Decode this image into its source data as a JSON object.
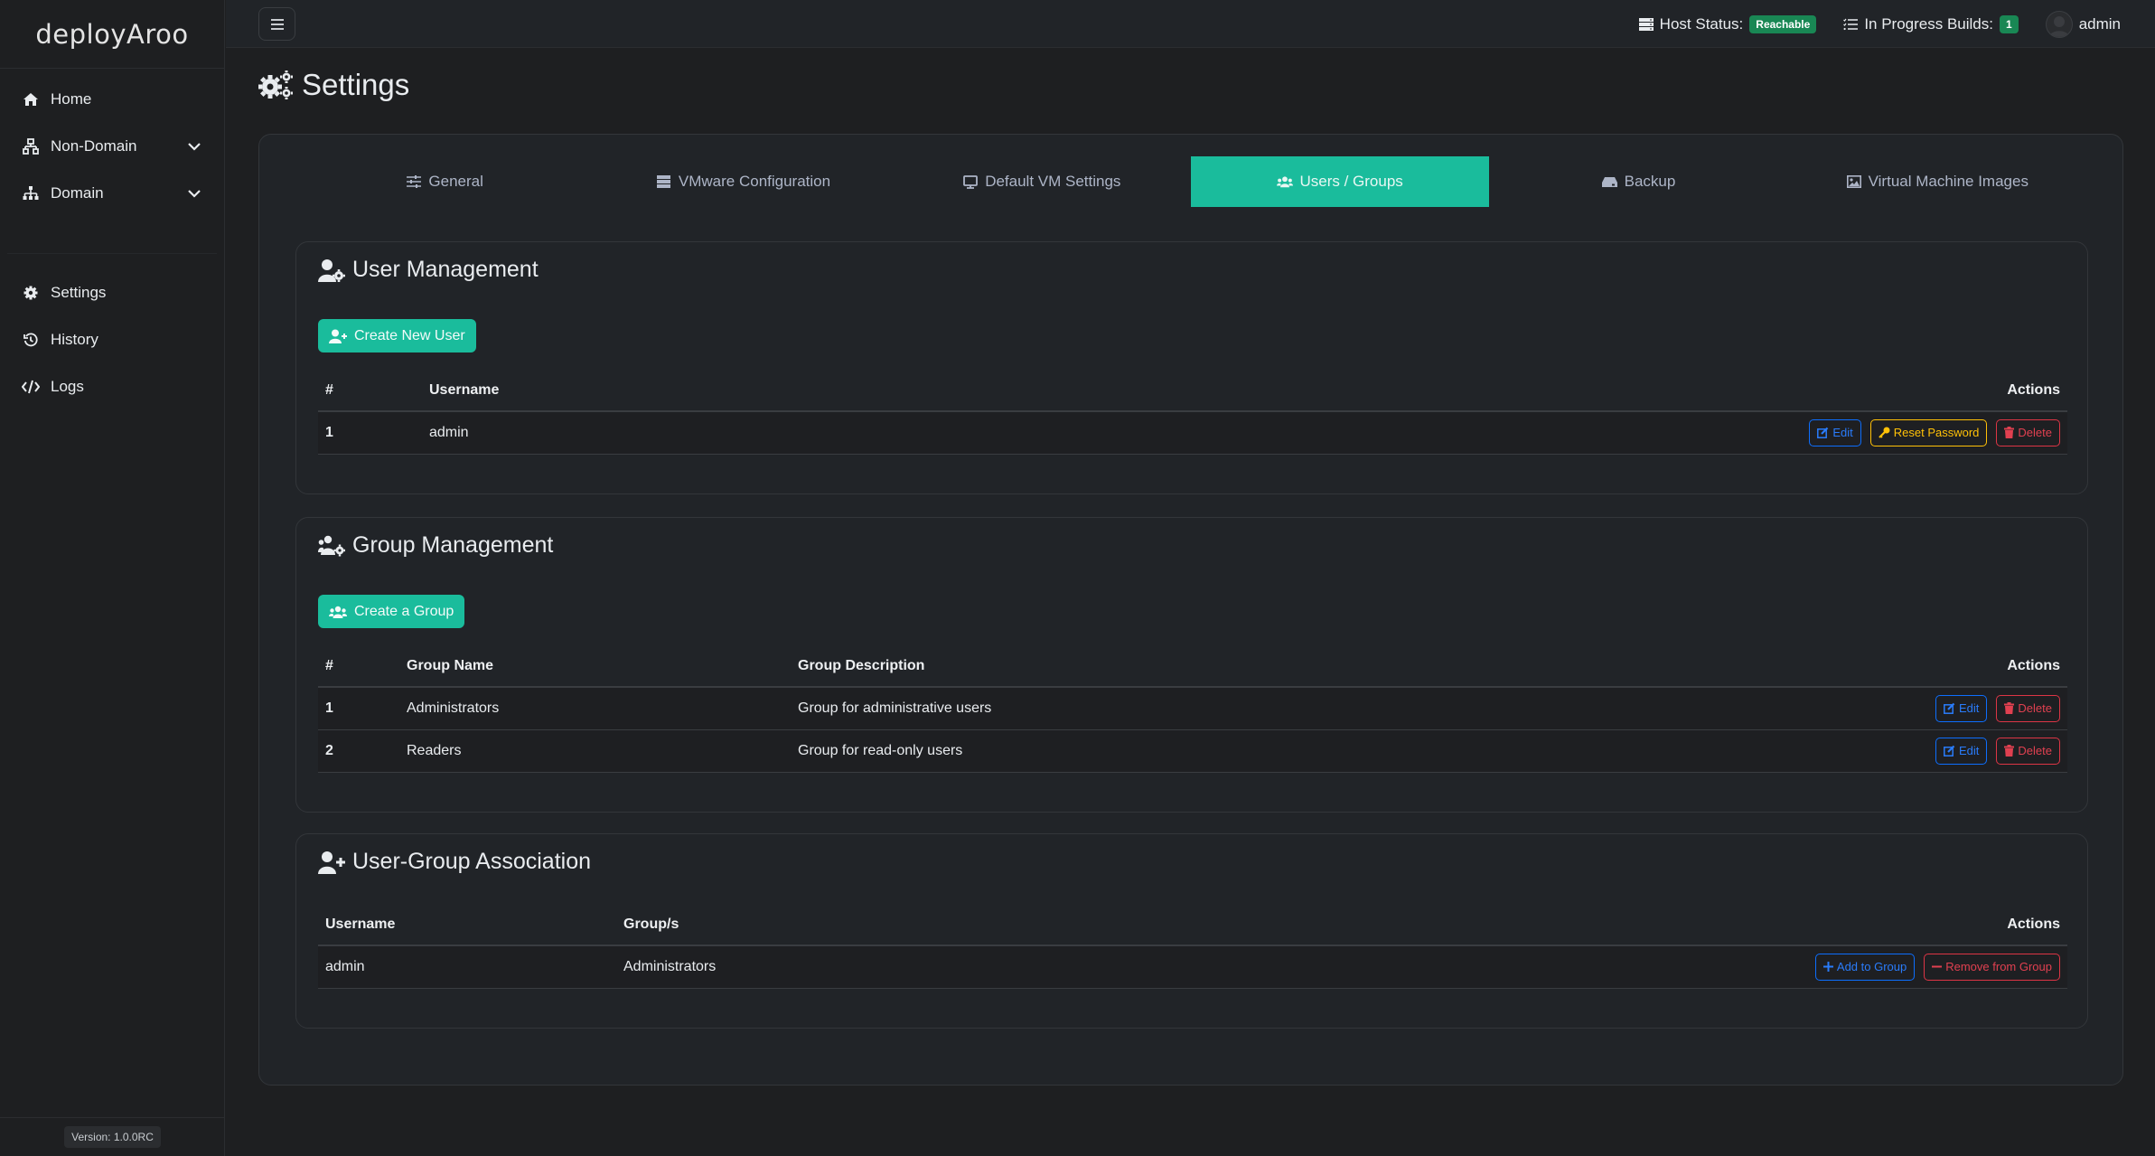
{
  "app": {
    "brand": "deployAroo",
    "version": "Version: 1.0.0RC"
  },
  "sidebar": {
    "items": [
      {
        "label": "Home",
        "icon": "home-icon"
      },
      {
        "label": "Non-Domain",
        "icon": "network-icon",
        "expandable": true
      },
      {
        "label": "Domain",
        "icon": "sitemap-icon",
        "expandable": true
      },
      {
        "label": "Settings",
        "icon": "gear-icon"
      },
      {
        "label": "History",
        "icon": "history-icon"
      },
      {
        "label": "Logs",
        "icon": "code-icon"
      }
    ]
  },
  "topbar": {
    "host_status_label": "Host Status:",
    "host_status_value": "Reachable",
    "builds_label": "In Progress Builds:",
    "builds_count": "1",
    "username": "admin"
  },
  "page": {
    "title": "Settings"
  },
  "tabs": [
    {
      "label": "General",
      "icon": "sliders-icon",
      "active": false
    },
    {
      "label": "VMware Configuration",
      "icon": "server-icon",
      "active": false
    },
    {
      "label": "Default VM Settings",
      "icon": "monitor-icon",
      "active": false
    },
    {
      "label": "Users / Groups",
      "icon": "users-icon",
      "active": true
    },
    {
      "label": "Backup",
      "icon": "hdd-icon",
      "active": false
    },
    {
      "label": "Virtual Machine Images",
      "icon": "image-icon",
      "active": false
    }
  ],
  "user_management": {
    "title": "User Management",
    "create_button": "Create New User",
    "columns": [
      "#",
      "Username",
      "Actions"
    ],
    "rows": [
      {
        "num": "1",
        "username": "admin"
      }
    ],
    "actions": {
      "edit": "Edit",
      "reset": "Reset Password",
      "delete": "Delete"
    }
  },
  "group_management": {
    "title": "Group Management",
    "create_button": "Create a Group",
    "columns": [
      "#",
      "Group Name",
      "Group Description",
      "Actions"
    ],
    "rows": [
      {
        "num": "1",
        "name": "Administrators",
        "description": "Group for administrative users"
      },
      {
        "num": "2",
        "name": "Readers",
        "description": "Group for read-only users"
      }
    ],
    "actions": {
      "edit": "Edit",
      "delete": "Delete"
    }
  },
  "association": {
    "title": "User-Group Association",
    "columns": [
      "Username",
      "Group/s",
      "Actions"
    ],
    "rows": [
      {
        "username": "admin",
        "groups": "Administrators"
      }
    ],
    "actions": {
      "add": "Add to Group",
      "remove": "Remove from Group"
    }
  },
  "colors": {
    "accent": "#1abc9c",
    "success": "#198754",
    "primary": "#0d6efd",
    "warning": "#ffc107",
    "danger": "#dc3545"
  }
}
